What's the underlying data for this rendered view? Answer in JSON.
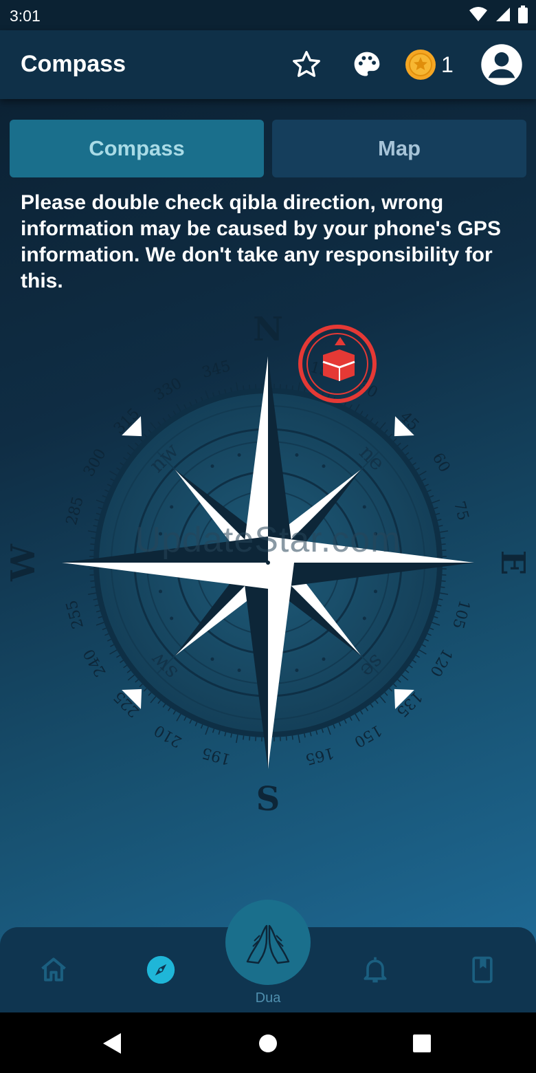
{
  "status": {
    "time": "3:01"
  },
  "appbar": {
    "title": "Compass",
    "coin_count": "1",
    "icons": [
      "star-icon",
      "palette-icon",
      "coin-icon",
      "account-icon"
    ]
  },
  "tabs": [
    {
      "label": "Compass",
      "selected": true
    },
    {
      "label": "Map",
      "selected": false
    }
  ],
  "disclaimer": "Please double check qibla direction, wrong information may be caused by your phone's GPS information. We don't take any responsibility for this.",
  "compass": {
    "cardinals": {
      "north": "N",
      "east": "E",
      "south": "S",
      "west": "W"
    },
    "intercardinals": {
      "ne": "ne",
      "se": "se",
      "sw": "sw",
      "nw": "nw"
    },
    "degrees": [
      "15",
      "30",
      "45",
      "60",
      "75",
      "105",
      "120",
      "135",
      "150",
      "165",
      "195",
      "210",
      "225",
      "240",
      "255",
      "285",
      "300",
      "315",
      "330",
      "345"
    ],
    "qibla_marker": "kaaba-icon"
  },
  "watermark": "UpdateStar.com",
  "nav": {
    "dua_label": "Dua",
    "items": [
      "home-icon",
      "compass-icon",
      "dua-hands-icon",
      "bell-icon",
      "book-icon"
    ]
  },
  "colors": {
    "accent": "#1a6f8c",
    "qibla_marker": "#e53935",
    "active_nav": "#1fb6d8"
  }
}
